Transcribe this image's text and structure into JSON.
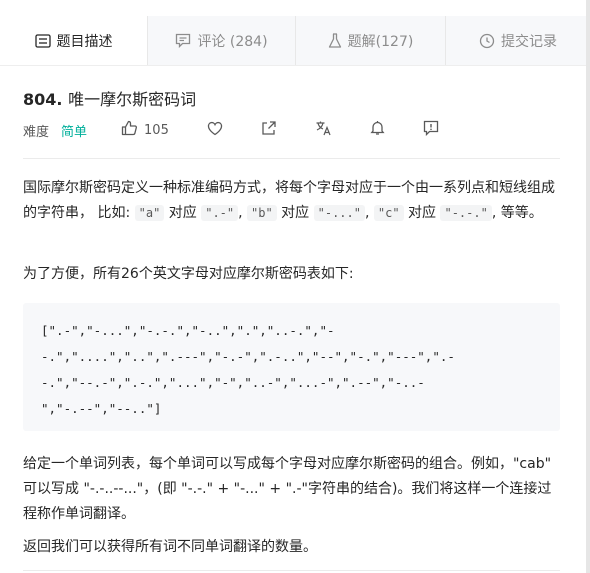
{
  "tabs": [
    {
      "label": "题目描述",
      "icon": "description-icon",
      "active": true
    },
    {
      "label": "评论 (284)",
      "icon": "comment-icon",
      "active": false
    },
    {
      "label": "题解(127)",
      "icon": "flask-icon",
      "active": false
    },
    {
      "label": "提交记录",
      "icon": "clock-icon",
      "active": false
    }
  ],
  "problem": {
    "number": "804.",
    "name": "唯一摩尔斯密码词",
    "difficulty_label": "难度",
    "difficulty": "简单",
    "likes": "105"
  },
  "description": {
    "p1_text": "国际摩尔斯密码定义一种标准编码方式，将每个字母对应于一个由一系列点和短线组成的字符串， 比如: ",
    "ex_a": "\"a\"",
    "ex_a_code": "\".-\"",
    "ex_b": "\"b\"",
    "ex_b_code": "\"-...\"",
    "ex_c": "\"c\"",
    "ex_c_code": "\"-.-.\"",
    "word_duiying": " 对应 ",
    "word_sep": ", ",
    "word_end": ", 等等。",
    "p2": "为了方便，所有26个英文字母对应摩尔斯密码表如下:",
    "code_lines": [
      "[\".-\",\"-...\",\"-.-.\",\"-..\",\".\",\"..-.\",\"-",
      "-.\",\"....\",\"..\",\".---\",\"-.-\",\".-..\",\"--\",\"-.\",\"---\",\".-",
      "-.\",\"--.-\",\".-.\",\"...\",\"-\",\"..-\",\"...-\",\".--\",\"-..-",
      "\",\"-.--\",\"--..\"]"
    ],
    "p3": "给定一个单词列表，每个单词可以写成每个字母对应摩尔斯密码的组合。例如，\"cab\" 可以写成 \"-.-..--...\"，(即 \"-.-.\" + \"-...\" + \".-\"字符串的结合)。我们将这样一个连接过程称作单词翻译。",
    "p4": "返回我们可以获得所有词不同单词翻译的数量。"
  },
  "colors": {
    "easy": "#00af9b",
    "text": "#262626",
    "muted": "#8c8c8c"
  }
}
